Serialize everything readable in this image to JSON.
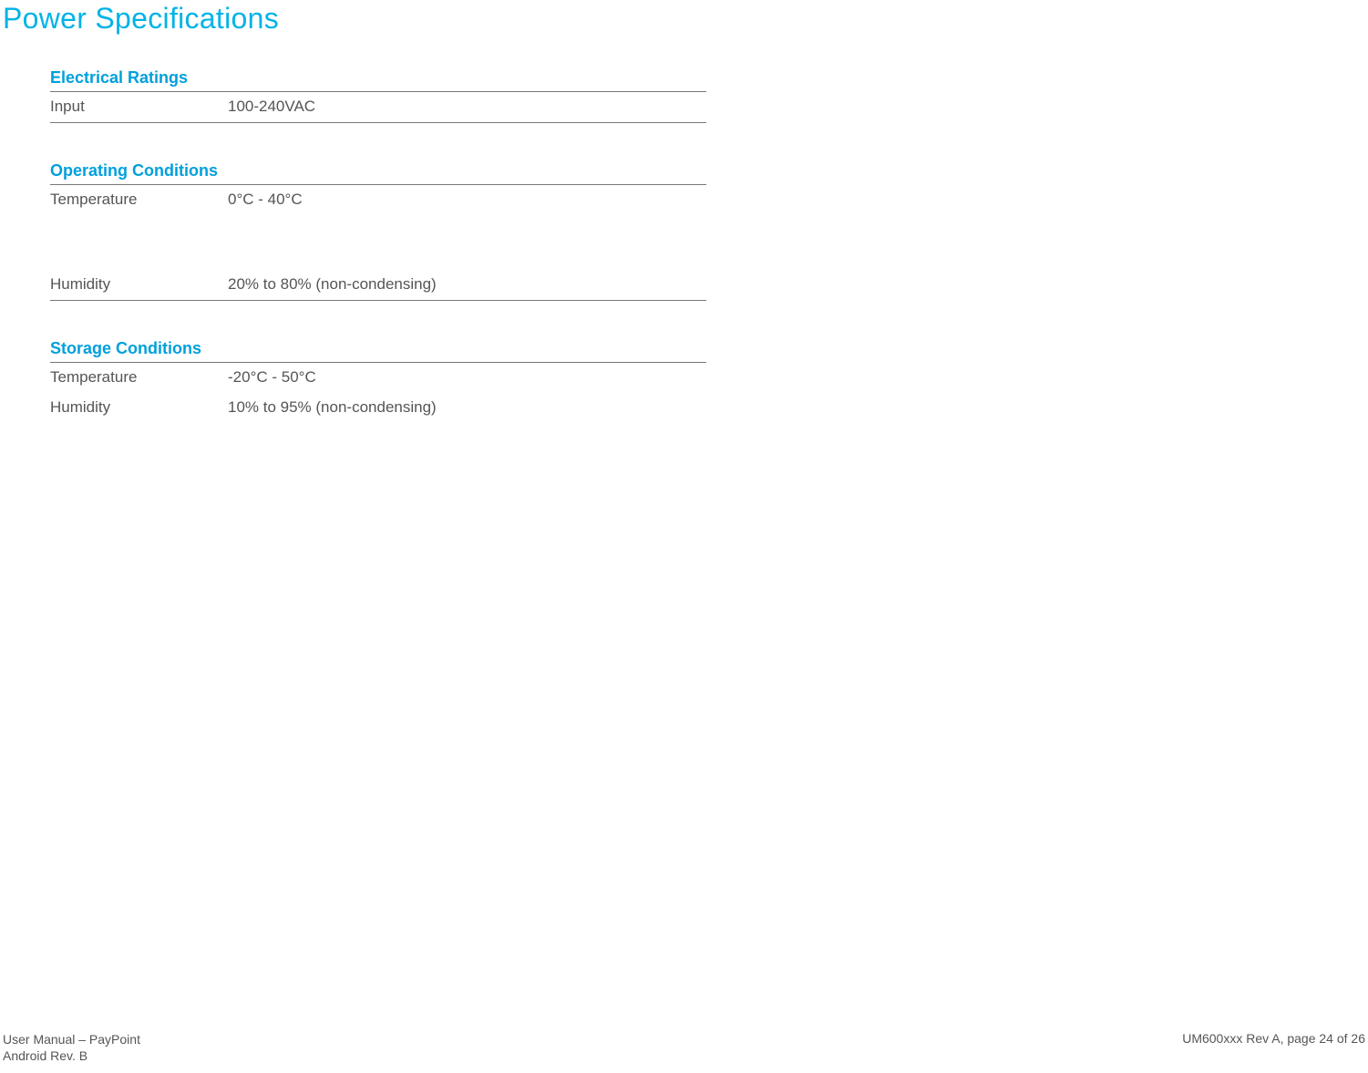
{
  "title": "Power Specifications",
  "sections": {
    "electrical": {
      "title": "Electrical Ratings",
      "rows": [
        {
          "label": "Input",
          "value": "100-240VAC"
        }
      ]
    },
    "operating": {
      "title": "Operating Conditions",
      "rows": [
        {
          "label": "Temperature",
          "value": "0°C - 40°C"
        },
        {
          "label": "Humidity",
          "value": "20% to 80% (non-condensing)"
        }
      ]
    },
    "storage": {
      "title": "Storage Conditions",
      "rows": [
        {
          "label": "Temperature",
          "value": "-20°C - 50°C"
        },
        {
          "label": "Humidity",
          "value": "10% to 95% (non-condensing)"
        }
      ]
    }
  },
  "footer": {
    "left_line1": "User Manual – PayPoint",
    "left_line2": "Android Rev. B",
    "right": "UM600xxx Rev A, page 24 of 26"
  }
}
